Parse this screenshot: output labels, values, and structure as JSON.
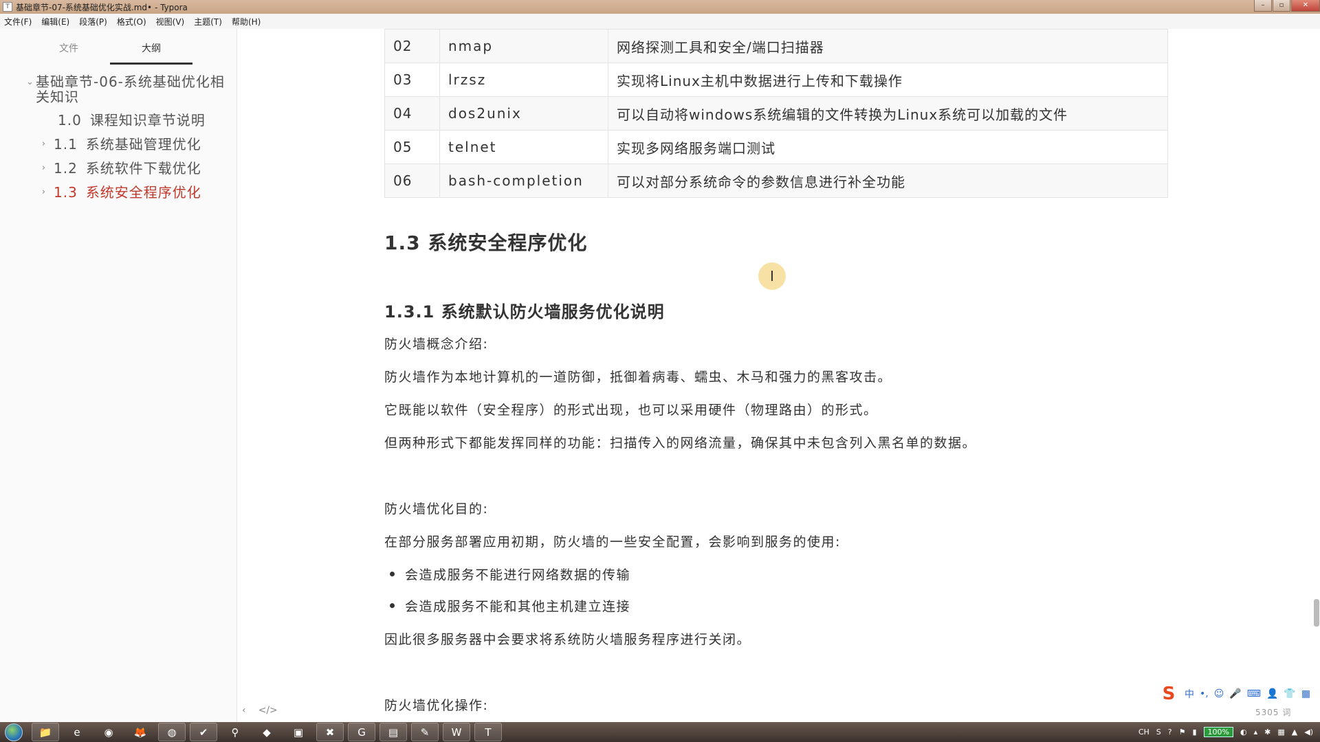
{
  "window": {
    "title": "基础章节-07-系统基础优化实战.md• - Typora",
    "app_icon": "T",
    "controls": [
      "–",
      "▫",
      "✕"
    ]
  },
  "menu": [
    "文件(F)",
    "编辑(E)",
    "段落(P)",
    "格式(O)",
    "视图(V)",
    "主题(T)",
    "帮助(H)"
  ],
  "sidebar": {
    "tabs": [
      "文件",
      "大纲"
    ],
    "active_tab": "大纲",
    "outline": [
      {
        "num": "",
        "label": "基础章节-06-系统基础优化相关知识",
        "chevron": "⌄"
      },
      {
        "num": "1.0",
        "label": "课程知识章节说明",
        "chevron": ""
      },
      {
        "num": "1.1",
        "label": "系统基础管理优化",
        "chevron": "›"
      },
      {
        "num": "1.2",
        "label": "系统软件下载优化",
        "chevron": "›"
      },
      {
        "num": "1.3",
        "label": "系统安全程序优化",
        "chevron": "›"
      }
    ],
    "bottom": [
      "‹",
      "</>"
    ]
  },
  "table": {
    "rows": [
      [
        "02",
        "nmap",
        "网络探测工具和安全/端口扫描器"
      ],
      [
        "03",
        "lrzsz",
        "实现将Linux主机中数据进行上传和下载操作"
      ],
      [
        "04",
        "dos2unix",
        "可以自动将windows系统编辑的文件转换为Linux系统可以加载的文件"
      ],
      [
        "05",
        "telnet",
        "实现多网络服务端口测试"
      ],
      [
        "06",
        "bash-completion",
        "可以对部分系统命令的参数信息进行补全功能"
      ]
    ]
  },
  "doc": {
    "h2": "1.3 系统安全程序优化",
    "h3": "1.3.1 系统默认防火墙服务优化说明",
    "p1": "防火墙概念介绍:",
    "p2": "防火墙作为本地计算机的一道防御，抵御着病毒、蠕虫、木马和强力的黑客攻击。",
    "p3": "它既能以软件（安全程序）的形式出现，也可以采用硬件（物理路由）的形式。",
    "p4": "但两种形式下都能发挥同样的功能：扫描传入的网络流量，确保其中未包含列入黑名单的数据。",
    "p5": "防火墙优化目的:",
    "p6": "在部分服务部署应用初期，防火墙的一些安全配置，会影响到服务的使用:",
    "bullets": [
      "会造成服务不能进行网络数据的传输",
      "会造成服务不能和其他主机建立连接"
    ],
    "p7": "因此很多服务器中会要求将系统防火墙服务程序进行关闭。",
    "p8": "防火墙优化操作:"
  },
  "cursor_glyph": "I",
  "ime": {
    "logo": "S",
    "items": [
      "中",
      "•,",
      "☺",
      "🎤",
      "⌨",
      "👤",
      "👕",
      "▦"
    ]
  },
  "wordcount": "5305 词",
  "taskbar": {
    "apps": [
      "📁",
      "e",
      "◉",
      "🦊",
      "◍",
      "✔",
      "⚲",
      "◆",
      "▣",
      "✖",
      "G",
      "▤",
      "✎",
      "W",
      "T"
    ],
    "tray": [
      "CH",
      "S",
      "?",
      "⚑",
      "▮"
    ],
    "battery": "100%",
    "tray_right": [
      "◐",
      "▴",
      "✱",
      "▦",
      "▲",
      "◀)"
    ]
  },
  "colors": {
    "accent_active": "#c0392b",
    "titlebar": "#d0ae92"
  }
}
